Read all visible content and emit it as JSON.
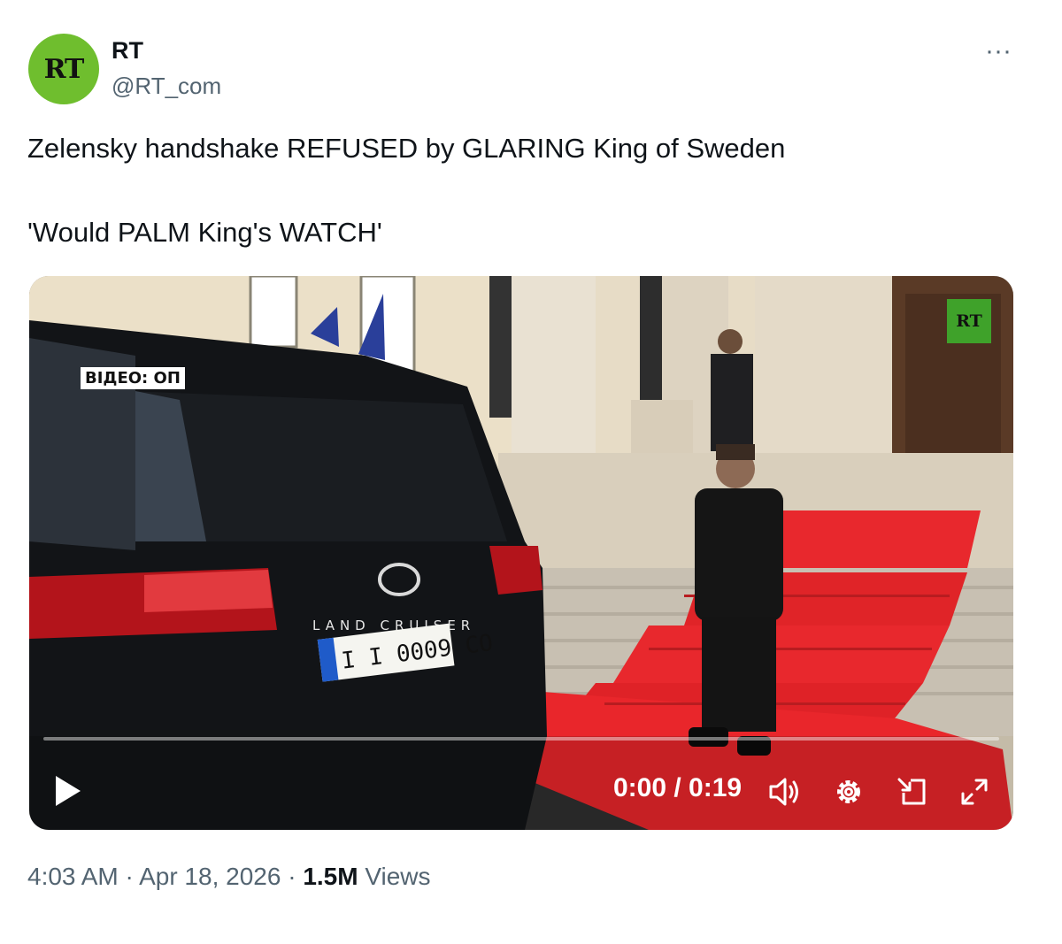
{
  "author": {
    "avatar_text": "RT",
    "name": "RT",
    "handle": "@RT_com"
  },
  "more_icon": "more-icon",
  "tweet": {
    "line1": "Zelensky handshake REFUSED by GLARING King of Sweden",
    "line2": "'Would PALM King's WATCH'"
  },
  "video": {
    "watermark": "RT",
    "overlay_label": "ВІДЕО: ОП",
    "plate_text": "I I 0009 CO",
    "car_model": "LAND CRUISER",
    "time": "0:00 / 0:19",
    "progress": 0.0,
    "controls": [
      "play-icon",
      "volume-icon",
      "gear-icon",
      "dock-icon",
      "fullscreen-icon"
    ]
  },
  "footer": {
    "time": "4:03 AM",
    "sep1": " · ",
    "date": "Apr 18, 2026",
    "sep2": " · ",
    "views_count": "1.5M",
    "views_label": " Views"
  },
  "colors": {
    "rt_green": "#6fbe2e",
    "carpet_red": "#e8282d",
    "muted_text": "#536471"
  }
}
